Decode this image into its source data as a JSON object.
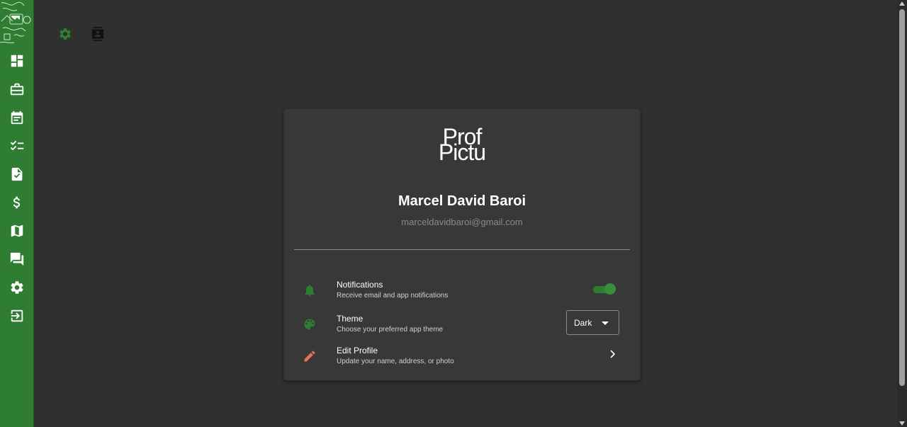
{
  "app": {
    "brand_color": "#2e7d32",
    "background": "#303030",
    "card_background": "#383838"
  },
  "sidebar": {
    "logo_icon": "broken-image-logo",
    "items": [
      {
        "name": "dashboard",
        "icon": "dashboard-icon"
      },
      {
        "name": "jobs",
        "icon": "briefcase-icon"
      },
      {
        "name": "calendar",
        "icon": "calendar-icon"
      },
      {
        "name": "tasks",
        "icon": "checklist-icon"
      },
      {
        "name": "documents",
        "icon": "document-check-icon"
      },
      {
        "name": "payments",
        "icon": "dollar-icon"
      },
      {
        "name": "map",
        "icon": "map-icon"
      },
      {
        "name": "messages",
        "icon": "chat-icon"
      },
      {
        "name": "settings",
        "icon": "gear-icon"
      },
      {
        "name": "logout",
        "icon": "logout-icon"
      }
    ]
  },
  "topbar": {
    "icons": [
      "gear-icon",
      "contact-card-icon"
    ]
  },
  "profile": {
    "picture_alt_line1": "Prof",
    "picture_alt_line2": "Pictu",
    "name": "Marcel David Baroi",
    "email": "marceldavidbaroi@gmail.com"
  },
  "settings": {
    "notifications": {
      "title": "Notifications",
      "subtitle": "Receive email and app notifications",
      "enabled": true,
      "icon": "bell-icon"
    },
    "theme": {
      "title": "Theme",
      "subtitle": "Choose your preferred app theme",
      "selected": "Dark",
      "icon": "palette-icon"
    },
    "edit_profile": {
      "title": "Edit Profile",
      "subtitle": "Update your name, address, or photo",
      "icon": "pencil-icon"
    }
  }
}
